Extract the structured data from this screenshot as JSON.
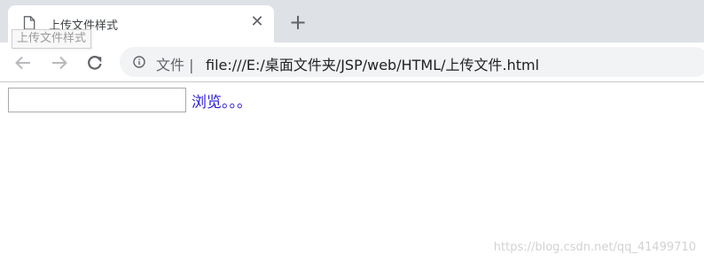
{
  "browser": {
    "tab": {
      "title": "上传文件样式",
      "close_icon": "close-icon",
      "favicon": "document-icon"
    },
    "new_tab_icon": "plus-icon",
    "tooltip": "上传文件样式",
    "toolbar": {
      "back_icon": "arrow-left-icon",
      "forward_icon": "arrow-right-icon",
      "reload_icon": "reload-icon",
      "info_icon": "info-icon",
      "site_chip": "文件 |",
      "url": "file:///E:/桌面文件夹/JSP/web/HTML/上传文件.html"
    }
  },
  "page": {
    "file_input": {
      "value": "",
      "placeholder": ""
    },
    "browse_link": "浏览。。。"
  },
  "watermark": "https://blog.csdn.net/qq_41499710",
  "colors": {
    "tabstrip": "#dee1e6",
    "omnibox": "#f1f3f4",
    "link": "#2a1bd6"
  }
}
